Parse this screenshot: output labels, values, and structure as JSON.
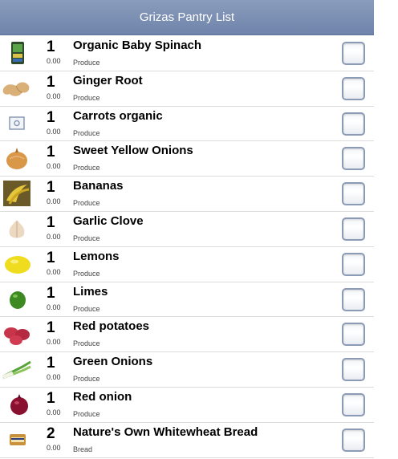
{
  "header": {
    "title": "Grizas Pantry List"
  },
  "items": [
    {
      "qty": "1",
      "price": "0.00",
      "name": "Organic Baby Spinach",
      "category": "Produce",
      "icon": "spinach-package-icon"
    },
    {
      "qty": "1",
      "price": "0.00",
      "name": "Ginger Root",
      "category": "Produce",
      "icon": "ginger-icon"
    },
    {
      "qty": "1",
      "price": "0.00",
      "name": "Carrots organic",
      "category": "Produce",
      "icon": "image-placeholder-icon"
    },
    {
      "qty": "1",
      "price": "0.00",
      "name": "Sweet Yellow Onions",
      "category": "Produce",
      "icon": "onion-icon"
    },
    {
      "qty": "1",
      "price": "0.00",
      "name": "Bananas",
      "category": "Produce",
      "icon": "bananas-icon"
    },
    {
      "qty": "1",
      "price": "0.00",
      "name": "Garlic Clove",
      "category": "Produce",
      "icon": "garlic-icon"
    },
    {
      "qty": "1",
      "price": "0.00",
      "name": "Lemons",
      "category": "Produce",
      "icon": "lemon-icon"
    },
    {
      "qty": "1",
      "price": "0.00",
      "name": "Limes",
      "category": "Produce",
      "icon": "lime-icon"
    },
    {
      "qty": "1",
      "price": "0.00",
      "name": "Red potatoes",
      "category": "Produce",
      "icon": "red-potatoes-icon"
    },
    {
      "qty": "1",
      "price": "0.00",
      "name": "Green Onions",
      "category": "Produce",
      "icon": "green-onions-icon"
    },
    {
      "qty": "1",
      "price": "0.00",
      "name": "Red onion",
      "category": "Produce",
      "icon": "red-onion-icon"
    },
    {
      "qty": "2",
      "price": "0.00",
      "name": "Nature's Own Whitewheat Bread",
      "category": "Bread",
      "icon": "bread-loaf-icon"
    }
  ]
}
